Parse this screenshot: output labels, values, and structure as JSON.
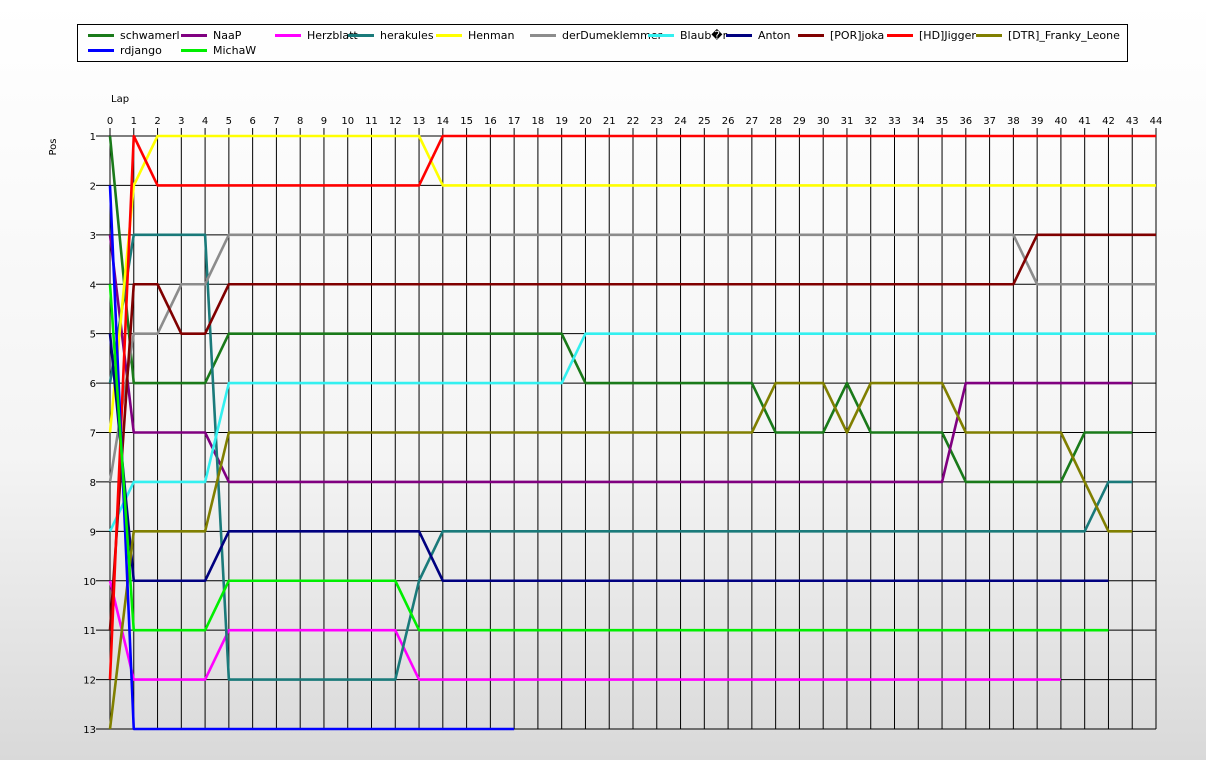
{
  "chart_data": {
    "type": "line",
    "xlabel": "Lap",
    "ylabel": "Pos",
    "xlim": [
      0,
      44
    ],
    "ylim": [
      1,
      13
    ],
    "x_ticks": [
      0,
      1,
      2,
      3,
      4,
      5,
      6,
      7,
      8,
      9,
      10,
      11,
      12,
      13,
      14,
      15,
      16,
      17,
      18,
      19,
      20,
      21,
      22,
      23,
      24,
      25,
      26,
      27,
      28,
      29,
      30,
      31,
      32,
      33,
      34,
      35,
      36,
      37,
      38,
      39,
      40,
      41,
      42,
      43,
      44
    ],
    "y_ticks": [
      1,
      2,
      3,
      4,
      5,
      6,
      7,
      8,
      9,
      10,
      11,
      12,
      13
    ],
    "y_inverted": true,
    "grid": true,
    "legend_position": "top",
    "series": [
      {
        "name": "schwamerl",
        "color": "#1a7a1a",
        "points": [
          [
            0,
            1
          ],
          [
            1,
            6
          ],
          [
            4,
            6
          ],
          [
            5,
            5
          ],
          [
            19,
            5
          ],
          [
            20,
            6
          ],
          [
            27,
            6
          ],
          [
            28,
            7
          ],
          [
            30,
            7
          ],
          [
            31,
            6
          ],
          [
            32,
            7
          ],
          [
            35,
            7
          ],
          [
            36,
            8
          ],
          [
            40,
            8
          ],
          [
            41,
            7
          ],
          [
            43,
            7
          ]
        ]
      },
      {
        "name": "NaaP",
        "color": "#800080",
        "points": [
          [
            0,
            3
          ],
          [
            1,
            7
          ],
          [
            4,
            7
          ],
          [
            5,
            8
          ],
          [
            35,
            8
          ],
          [
            36,
            6
          ],
          [
            43,
            6
          ]
        ]
      },
      {
        "name": "Herzblatt",
        "color": "#ff00ff",
        "points": [
          [
            0,
            10
          ],
          [
            1,
            12
          ],
          [
            4,
            12
          ],
          [
            5,
            11
          ],
          [
            12,
            11
          ],
          [
            13,
            12
          ],
          [
            40,
            12
          ]
        ]
      },
      {
        "name": "herakules",
        "color": "#1a7a7a",
        "points": [
          [
            0,
            6
          ],
          [
            1,
            3
          ],
          [
            4,
            3
          ],
          [
            5,
            12
          ],
          [
            12,
            12
          ],
          [
            13,
            10
          ],
          [
            14,
            9
          ],
          [
            41,
            9
          ],
          [
            42,
            8
          ],
          [
            43,
            8
          ]
        ]
      },
      {
        "name": "Henman",
        "color": "#ffff00",
        "points": [
          [
            0,
            7
          ],
          [
            1,
            2
          ],
          [
            2,
            1
          ],
          [
            13,
            1
          ],
          [
            14,
            2
          ],
          [
            44,
            2
          ]
        ]
      },
      {
        "name": "derDumeklemmer",
        "color": "#8c8c8c",
        "points": [
          [
            0,
            8
          ],
          [
            1,
            5
          ],
          [
            2,
            5
          ],
          [
            3,
            4
          ],
          [
            4,
            4
          ],
          [
            5,
            3
          ],
          [
            38,
            3
          ],
          [
            39,
            4
          ],
          [
            44,
            4
          ]
        ]
      },
      {
        "name": "Blaub�r",
        "color": "#33f0f0",
        "points": [
          [
            0,
            9
          ],
          [
            1,
            8
          ],
          [
            4,
            8
          ],
          [
            5,
            6
          ],
          [
            19,
            6
          ],
          [
            20,
            5
          ],
          [
            44,
            5
          ]
        ]
      },
      {
        "name": "Anton",
        "color": "#00007f",
        "points": [
          [
            0,
            5
          ],
          [
            1,
            10
          ],
          [
            4,
            10
          ],
          [
            5,
            9
          ],
          [
            13,
            9
          ],
          [
            14,
            10
          ],
          [
            42,
            10
          ]
        ]
      },
      {
        "name": "[POR]joka",
        "color": "#800000",
        "points": [
          [
            0,
            11
          ],
          [
            1,
            4
          ],
          [
            2,
            4
          ],
          [
            3,
            5
          ],
          [
            4,
            5
          ],
          [
            5,
            4
          ],
          [
            38,
            4
          ],
          [
            39,
            3
          ],
          [
            44,
            3
          ]
        ]
      },
      {
        "name": "[HD]Jigger",
        "color": "#ff0000",
        "points": [
          [
            0,
            12
          ],
          [
            1,
            1
          ],
          [
            2,
            2
          ],
          [
            13,
            2
          ],
          [
            14,
            1
          ],
          [
            44,
            1
          ]
        ]
      },
      {
        "name": "[DTR]_Franky_Leone",
        "color": "#807f00",
        "points": [
          [
            0,
            13
          ],
          [
            1,
            9
          ],
          [
            4,
            9
          ],
          [
            5,
            7
          ],
          [
            27,
            7
          ],
          [
            28,
            6
          ],
          [
            30,
            6
          ],
          [
            31,
            7
          ],
          [
            32,
            6
          ],
          [
            35,
            6
          ],
          [
            36,
            7
          ],
          [
            40,
            7
          ],
          [
            41,
            8
          ],
          [
            42,
            9
          ],
          [
            43,
            9
          ]
        ]
      },
      {
        "name": "rdjango",
        "color": "#0000ff",
        "points": [
          [
            0,
            2
          ],
          [
            1,
            13
          ],
          [
            17,
            13
          ]
        ]
      },
      {
        "name": "MichaW",
        "color": "#00ee00",
        "points": [
          [
            0,
            4
          ],
          [
            1,
            11
          ],
          [
            4,
            11
          ],
          [
            5,
            10
          ],
          [
            12,
            10
          ],
          [
            13,
            11
          ],
          [
            42,
            11
          ]
        ]
      }
    ]
  }
}
